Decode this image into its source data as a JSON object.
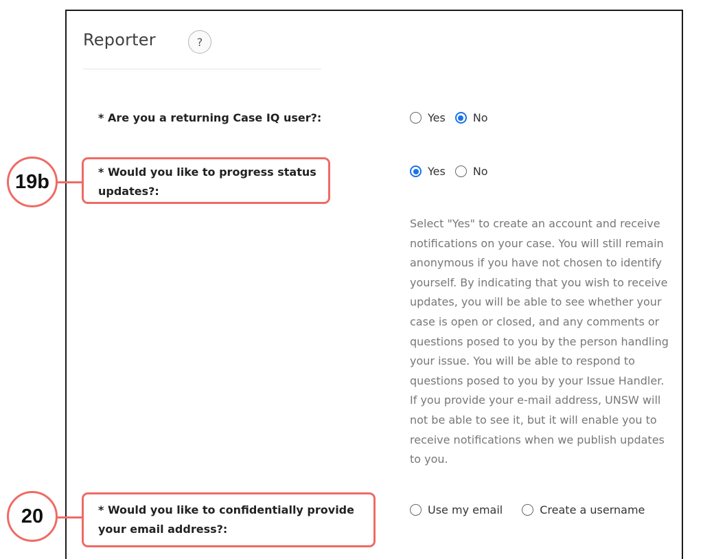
{
  "section": {
    "title": "Reporter",
    "help_glyph": "?"
  },
  "questions": [
    {
      "label": "* Are you a returning Case IQ user?:",
      "options": [
        "Yes",
        "No"
      ],
      "selected": "No"
    },
    {
      "label_line1": "* Would you like to progress status",
      "label_line2": "updates?:",
      "options": [
        "Yes",
        "No"
      ],
      "selected": "Yes",
      "callout": "19b",
      "help_lines": [
        "Select \"Yes\" to create an account and receive",
        "notifications on your case. You will still remain",
        "anonymous if you have not chosen to identify",
        "yourself. By indicating that you wish to receive",
        "updates, you will be able to see whether your",
        "case is open or closed, and any comments or",
        "questions posed to you by the person handling",
        "your issue. You will be able to respond to",
        "questions posed to you by your Issue Handler.",
        "If you provide your e-mail address, UNSW will",
        "not be able to see it, but it will enable you to",
        "receive notifications when we publish updates",
        "to you."
      ]
    },
    {
      "label_line1": "* Would you like to confidentially provide",
      "label_line2": "your email address?:",
      "options": [
        "Use my email",
        "Create a username"
      ],
      "selected": "",
      "callout": "20"
    }
  ],
  "colors": {
    "callout": "#ef6a64",
    "radio_selected": "#1a73e8",
    "help_text": "#777777"
  }
}
